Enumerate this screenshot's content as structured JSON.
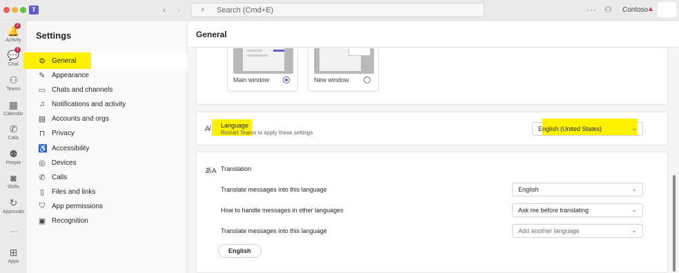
{
  "titlebar": {
    "logo": "T",
    "back_glyph": "‹",
    "forward_glyph": "›",
    "search_placeholder": "Search (Cmd+E)",
    "more_glyph": "···",
    "org_name": "Contoso"
  },
  "rail": [
    {
      "label": "Activity",
      "icon": "bell-icon",
      "glyph": "🔔",
      "badge": "2"
    },
    {
      "label": "Chat",
      "icon": "chat-icon",
      "glyph": "💬",
      "badge": "1"
    },
    {
      "label": "Teams",
      "icon": "teams-icon",
      "glyph": "⚇"
    },
    {
      "label": "Calendar",
      "icon": "calendar-icon",
      "glyph": "▦"
    },
    {
      "label": "Calls",
      "icon": "phone-icon",
      "glyph": "✆"
    },
    {
      "label": "People",
      "icon": "people-icon",
      "glyph": "⚉"
    },
    {
      "label": "Shifts",
      "icon": "shifts-icon",
      "glyph": "◙"
    },
    {
      "label": "Approvals",
      "icon": "approvals-icon",
      "glyph": "↻"
    },
    {
      "label": "",
      "icon": "more-apps-icon",
      "glyph": "···"
    },
    {
      "label": "Apps",
      "icon": "apps-icon",
      "glyph": "⊞"
    }
  ],
  "settings": {
    "title": "Settings",
    "items": [
      {
        "label": "General",
        "icon": "gear-icon",
        "glyph": "⚙",
        "selected": true
      },
      {
        "label": "Appearance",
        "icon": "wand-icon",
        "glyph": "✎"
      },
      {
        "label": "Chats and channels",
        "icon": "chat-bubble-icon",
        "glyph": "▭"
      },
      {
        "label": "Notifications and activity",
        "icon": "bell-icon",
        "glyph": "♫"
      },
      {
        "label": "Accounts and orgs",
        "icon": "id-card-icon",
        "glyph": "▤"
      },
      {
        "label": "Privacy",
        "icon": "lock-icon",
        "glyph": "⊓"
      },
      {
        "label": "Accessibility",
        "icon": "accessibility-icon",
        "glyph": "♿"
      },
      {
        "label": "Devices",
        "icon": "headset-icon",
        "glyph": "◎"
      },
      {
        "label": "Calls",
        "icon": "phone-icon",
        "glyph": "✆"
      },
      {
        "label": "Files and links",
        "icon": "file-icon",
        "glyph": "▯"
      },
      {
        "label": "App permissions",
        "icon": "shield-icon",
        "glyph": "⛉"
      },
      {
        "label": "Recognition",
        "icon": "recognition-icon",
        "glyph": "▣"
      }
    ]
  },
  "main": {
    "title": "General",
    "window_options": [
      {
        "label": "Main window",
        "selected": true
      },
      {
        "label": "New window",
        "selected": false
      }
    ],
    "language": {
      "title": "Language",
      "subtitle": "Restart Teams to apply these settings",
      "value": "English (United States)"
    },
    "translation": {
      "title": "Translation",
      "rows": [
        {
          "label": "Translate messages into this language",
          "value": "English",
          "placeholder": false
        },
        {
          "label": "How to handle messages in other languages",
          "value": "Ask me before translating",
          "placeholder": false
        },
        {
          "label": "Translate messages into this language",
          "value": "Add another language",
          "placeholder": true
        }
      ],
      "chip": "English"
    }
  },
  "colors": {
    "accent": "#5b5fc7",
    "highlight": "#fff200",
    "badge": "#c4314b"
  }
}
